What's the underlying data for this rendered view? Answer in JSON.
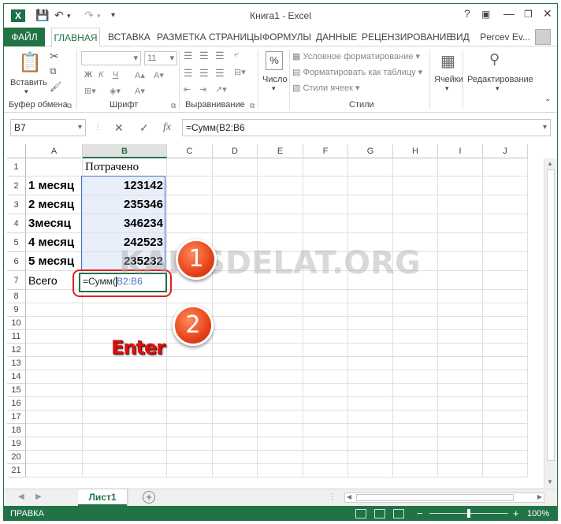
{
  "titlebar": {
    "app_icon": "X",
    "title": "Книга1 - Excel",
    "qat_icons": [
      "save-icon",
      "undo-icon",
      "redo-icon",
      "customize-icon"
    ],
    "window_icons": [
      "help-icon",
      "ribbon-options-icon",
      "minimize-icon",
      "restore-icon",
      "close-icon"
    ]
  },
  "tabs": {
    "file": "ФАЙЛ",
    "items": [
      "ГЛАВНАЯ",
      "ВСТАВКА",
      "РАЗМЕТКА СТРАНИЦЫ",
      "ФОРМУЛЫ",
      "ДАННЫЕ",
      "РЕЦЕНЗИРОВАНИЕ",
      "ВИД"
    ],
    "active": "ГЛАВНАЯ",
    "user": "Percev Ev..."
  },
  "ribbon": {
    "clipboard": {
      "paste": "Вставить",
      "label": "Буфер обмена"
    },
    "font": {
      "size": "11",
      "bold": "Ж",
      "italic": "К",
      "underline": "Ч",
      "label": "Шрифт"
    },
    "alignment": {
      "label": "Выравнивание"
    },
    "number": {
      "percent": "%",
      "button": "Число"
    },
    "styles": {
      "conditional": "Условное форматирование",
      "as_table": "Форматировать как таблицу",
      "cell_styles": "Стили ячеек",
      "label": "Стили"
    },
    "cells": {
      "button": "Ячейки"
    },
    "editing": {
      "button": "Редактирование"
    }
  },
  "formula_bar": {
    "name_box": "B7",
    "cancel": "✕",
    "enter": "✓",
    "fx": "fx",
    "formula": "=Сумм(B2:B6"
  },
  "grid": {
    "columns": [
      "A",
      "B",
      "C",
      "D",
      "E",
      "F",
      "G",
      "H",
      "I",
      "J"
    ],
    "selected_column": "B",
    "rows": [
      "1",
      "2",
      "3",
      "4",
      "5",
      "6",
      "7",
      "8",
      "9",
      "10",
      "11",
      "12",
      "13",
      "14",
      "15",
      "16",
      "17",
      "18",
      "19",
      "20",
      "21"
    ],
    "header_b1": "Потрачено",
    "data": [
      {
        "label": "1 месяц",
        "value": "123142"
      },
      {
        "label": "2 месяц",
        "value": "235346"
      },
      {
        "label": "3месяц",
        "value": "346234"
      },
      {
        "label": "4 месяц",
        "value": "242523"
      },
      {
        "label": "5 месяц",
        "value": "235232"
      }
    ],
    "total_label": "Всего",
    "edit_prefix": "=Сумм(",
    "edit_ref": "B2:B6"
  },
  "annotations": {
    "step1": "1",
    "step2": "2",
    "enter": "Enter",
    "watermark": "KAK-SDELAT.ORG"
  },
  "sheets": {
    "active": "Лист1",
    "add": "+"
  },
  "status": {
    "mode": "ПРАВКА",
    "zoom": "100%",
    "zoom_minus": "−",
    "zoom_plus": "+"
  }
}
